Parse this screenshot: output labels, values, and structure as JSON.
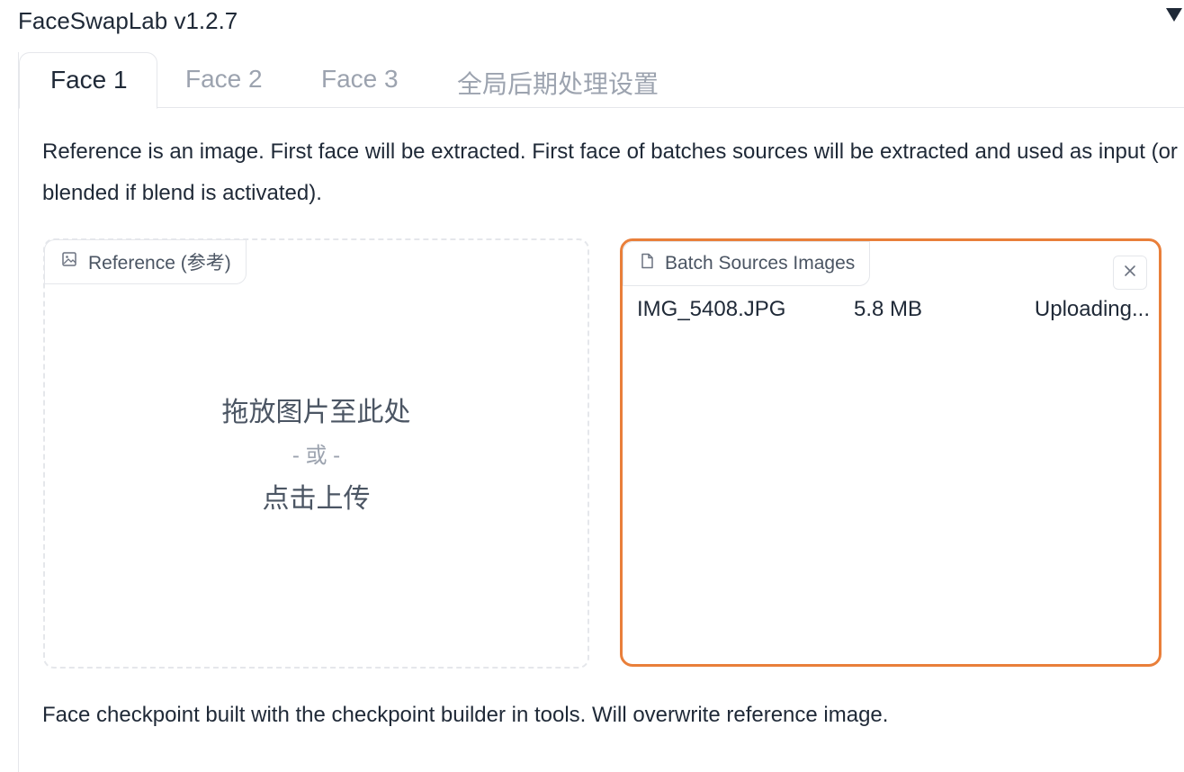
{
  "header": {
    "title": "FaceSwapLab v1.2.7",
    "collapse_icon": "triangle-down-icon"
  },
  "tabs": [
    {
      "label": "Face 1",
      "active": true
    },
    {
      "label": "Face 2",
      "active": false
    },
    {
      "label": "Face 3",
      "active": false
    },
    {
      "label": "全局后期处理设置",
      "active": false
    }
  ],
  "description": "Reference is an image. First face will be extracted. First face of batches sources will be extracted and used as input (or blended if blend is activated).",
  "reference": {
    "label": "Reference (参考)",
    "icon": "image-icon",
    "drop_text": "拖放图片至此处",
    "or_text": "- 或 -",
    "click_text": "点击上传"
  },
  "batch": {
    "label": "Batch Sources Images",
    "icon": "file-icon",
    "clear_icon": "close-icon",
    "accent_color": "#e97f3a",
    "files": [
      {
        "name": "IMG_5408.JPG",
        "size": "5.8 MB",
        "status": "Uploading..."
      }
    ]
  },
  "footer": {
    "text": "Face checkpoint built with the checkpoint builder in tools. Will overwrite reference image."
  }
}
